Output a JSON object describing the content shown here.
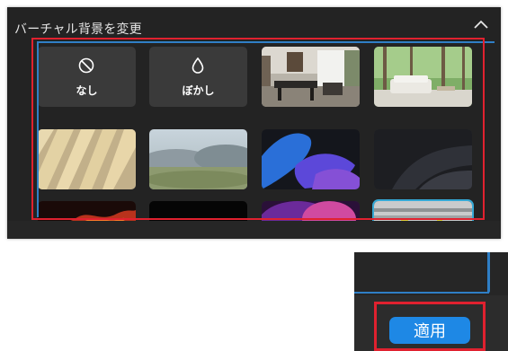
{
  "panel": {
    "title": "バーチャル背景を変更",
    "collapse_icon": "chevron-up-icon"
  },
  "backgrounds": [
    {
      "name": "tile-none",
      "label": "なし",
      "icon": "no-icon",
      "type": "option"
    },
    {
      "name": "tile-blur",
      "label": "ぼかし",
      "icon": "droplet-icon",
      "type": "option"
    },
    {
      "name": "tile-office",
      "type": "image"
    },
    {
      "name": "tile-living-forest",
      "type": "image"
    },
    {
      "name": "tile-sunlit-wall",
      "type": "image"
    },
    {
      "name": "tile-blurred-mountains",
      "type": "image"
    },
    {
      "name": "tile-blue-purple-shapes",
      "type": "image"
    },
    {
      "name": "tile-dark-waves",
      "type": "image"
    },
    {
      "name": "tile-fire",
      "type": "image"
    },
    {
      "name": "tile-black",
      "type": "image"
    },
    {
      "name": "tile-pink-purple",
      "type": "image"
    },
    {
      "name": "tile-warehouse",
      "type": "image",
      "selected": true
    }
  ],
  "apply": {
    "label": "適用"
  },
  "colors": {
    "highlight": "#e0212f",
    "selection": "#35a9d6",
    "accent_blue": "#1e88e5",
    "panel_bg": "#232323"
  }
}
